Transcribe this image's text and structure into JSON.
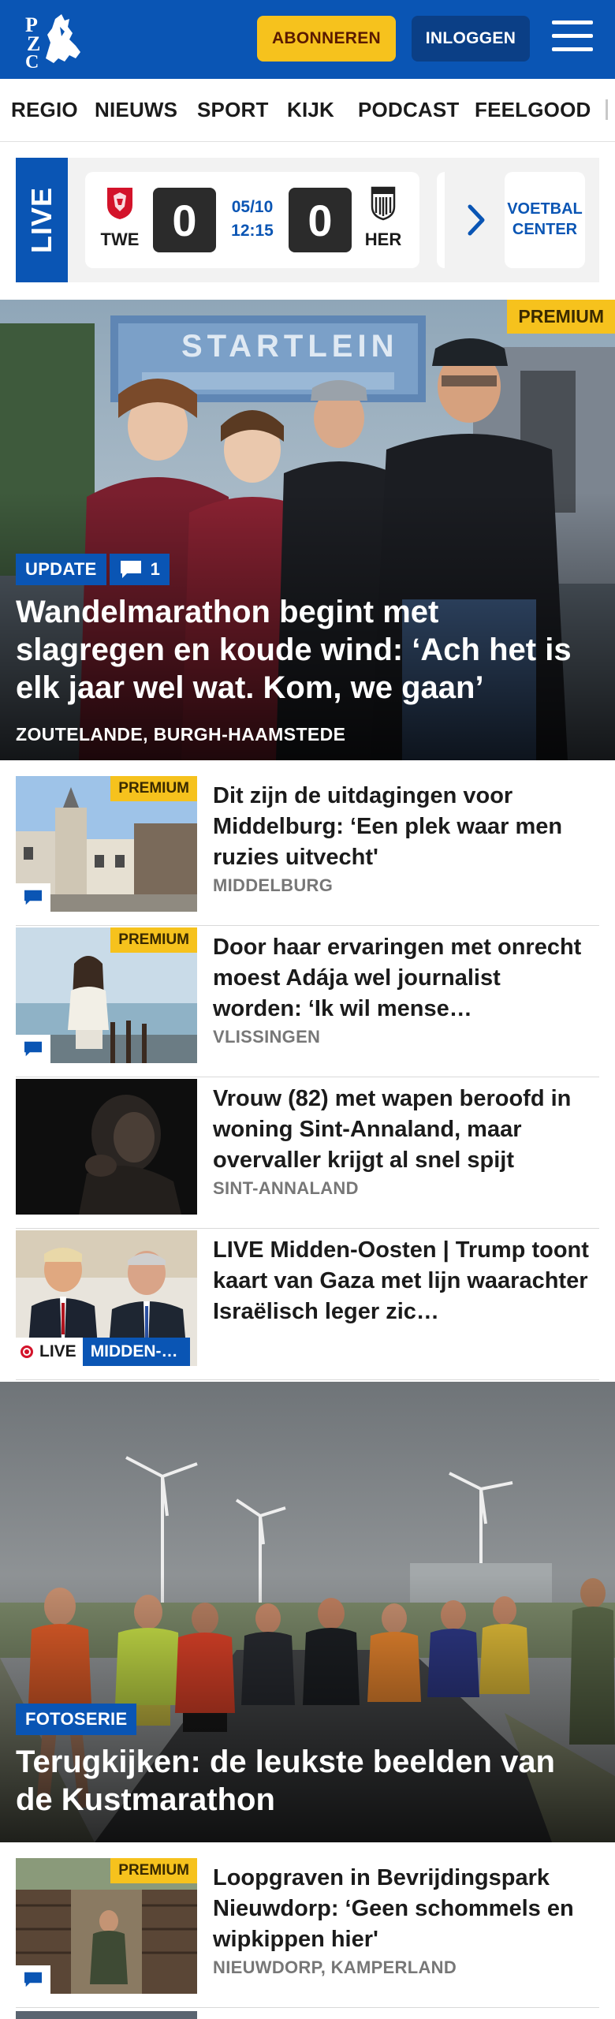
{
  "header": {
    "subscribe_label": "ABONNEREN",
    "login_label": "INLOGGEN",
    "brand_color": "#0a55b4",
    "accent_color": "#f6c21d"
  },
  "nav": {
    "items": [
      "REGIO",
      "NIEUWS",
      "SPORT",
      "KIJK",
      "PODCAST",
      "FEELGOOD"
    ]
  },
  "live": {
    "label": "LIVE",
    "match": {
      "home": "TWE",
      "home_score": "0",
      "date": "05/10",
      "time": "12:15",
      "away": "HER",
      "away_score": "0"
    },
    "voetbal_center": [
      "VOETBAL",
      "CENTER"
    ]
  },
  "hero": {
    "badge": "PREMIUM",
    "tag": "UPDATE",
    "comment_count": "1",
    "title": "Wandelmarathon begint met slagregen en koude wind: ‘Ach het is elk jaar wel wat. Kom, we gaan’",
    "location": "ZOUTELANDE, BURGH-HAAMSTEDE"
  },
  "articles": [
    {
      "premium": "PREMIUM",
      "title": "Dit zijn de uitdagingen voor Middelburg: ‘Een plek waar men ruzies uitvecht'",
      "location": "MIDDELBURG"
    },
    {
      "premium": "PREMIUM",
      "title": "Door haar ervaringen met onrecht moest Adája wel journalist worden: ‘Ik wil mense…",
      "location": "VLISSINGEN"
    },
    {
      "title": "Vrouw (82) met wapen beroofd in woning Sint-Annaland, maar overvaller krijgt al snel spijt",
      "location": "SINT-ANNALAND"
    },
    {
      "title": "LIVE Midden-Oosten | Trump toont kaart van Gaza met lijn waarachter Israëlisch leger zic…",
      "live_label": "LIVE",
      "category": "MIDDEN-…"
    }
  ],
  "hero2": {
    "tag": "FOTOSERIE",
    "title": "Terugkijken: de leukste beelden van de Kustmarathon"
  },
  "article_last": {
    "premium": "PREMIUM",
    "title": "Loopgraven in Bevrijdingspark Nieuwdorp: ‘Geen schommels en wipkippen hier'",
    "location": "NIEUWDORP, KAMPERLAND"
  }
}
